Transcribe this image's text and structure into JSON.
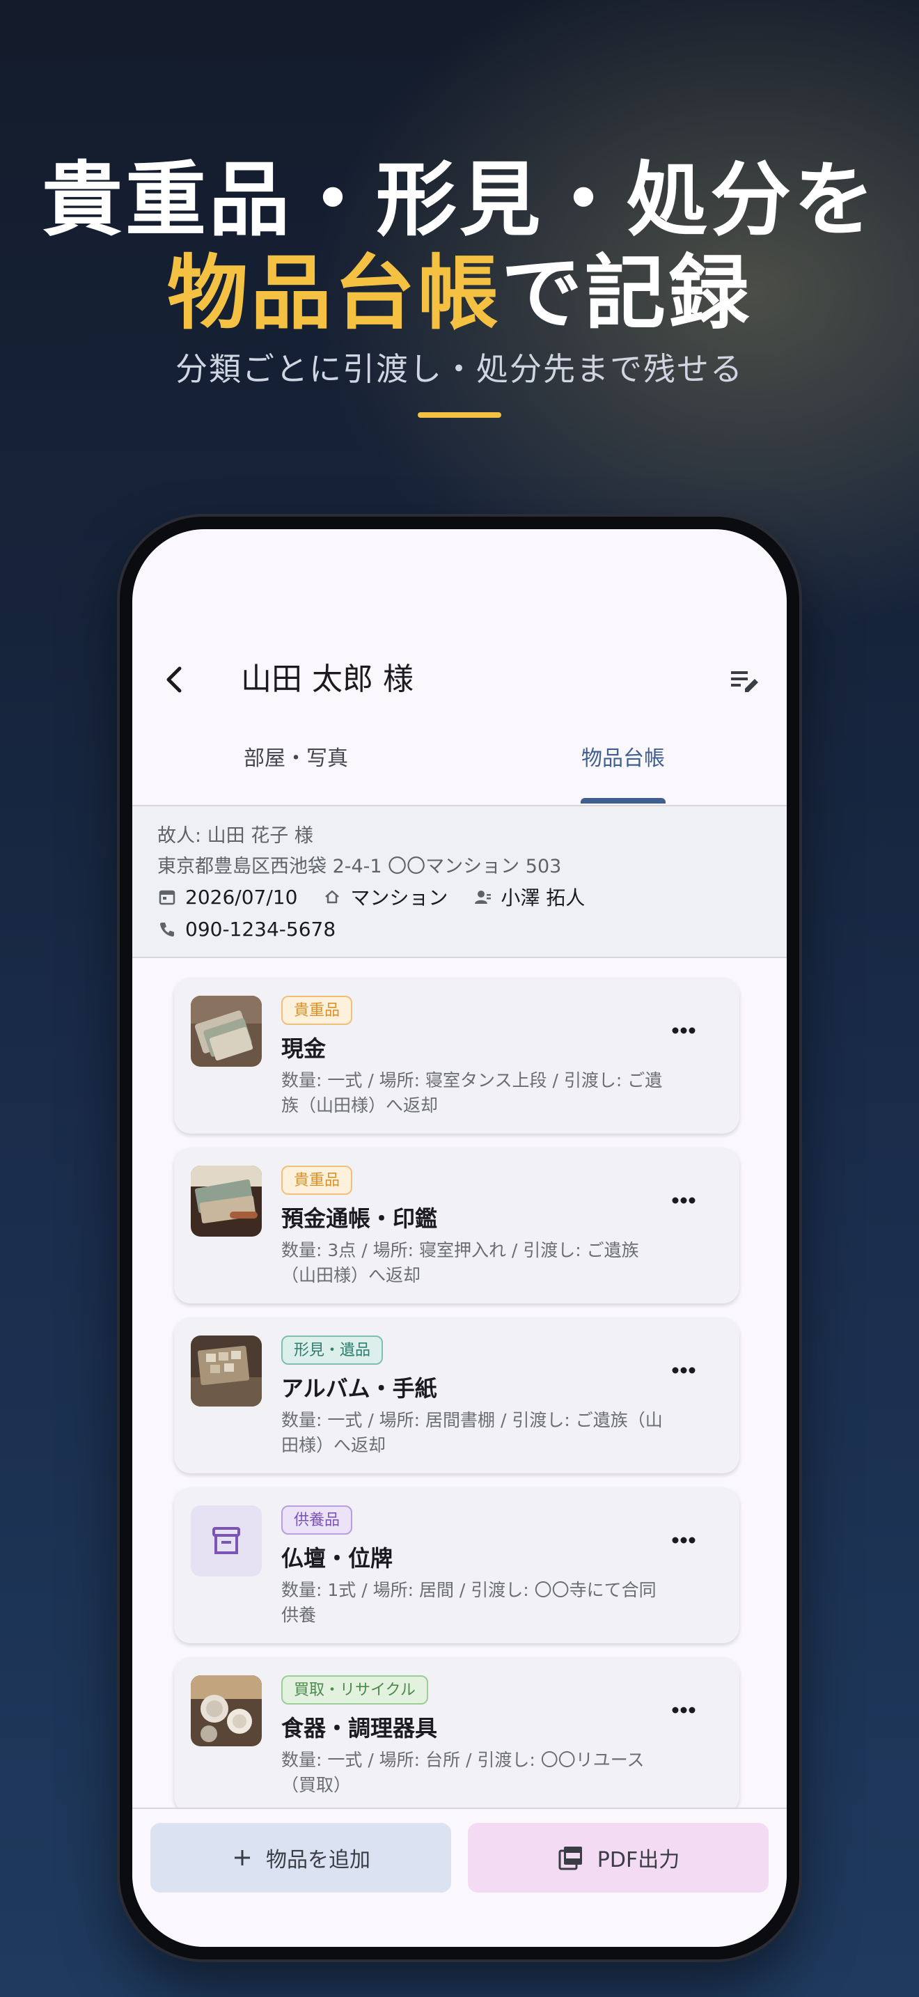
{
  "hero": {
    "line1": "貴重品・形見・処分を",
    "line2_accent": "物品台帳",
    "line2_rest": "で記録",
    "subtitle": "分類ごとに引渡し・処分先まで残せる",
    "accent_color": "#f4c143"
  },
  "appbar": {
    "title": "山田 太郎 様",
    "back_icon": "arrow-back-icon",
    "edit_icon": "edit-note-icon"
  },
  "tabs": [
    {
      "label": "部屋・写真",
      "active": false
    },
    {
      "label": "物品台帳",
      "active": true
    }
  ],
  "info": {
    "deceased": "故人: 山田 花子 様",
    "address": "東京都豊島区西池袋 2-4-1 〇〇マンション 503",
    "date": "2026/07/10",
    "building": "マンション",
    "staff": "小澤 拓人",
    "phone": "090-1234-5678"
  },
  "items": [
    {
      "tag": "貴重品",
      "name": "現金",
      "detail": "数量: 一式 / 場所: 寝室タンス上段 / 引渡し: ご遺族（山田様）へ返却",
      "thumb": "cash-photo"
    },
    {
      "tag": "貴重品",
      "name": "預金通帳・印鑑",
      "detail": "数量: 3点 / 場所: 寝室押入れ / 引渡し: ご遺族（山田様）へ返却",
      "thumb": "bankbook-photo"
    },
    {
      "tag": "形見・遺品",
      "name": "アルバム・手紙",
      "detail": "数量: 一式 / 場所: 居間書棚 / 引渡し: ご遺族（山田様）へ返却",
      "thumb": "album-photo"
    },
    {
      "tag": "供養品",
      "name": "仏壇・位牌",
      "detail": "数量: 1式 / 場所: 居間 / 引渡し: 〇〇寺にて合同供養",
      "thumb": "archive-icon"
    },
    {
      "tag": "買取・リサイクル",
      "name": "食器・調理器具",
      "detail": "数量: 一式 / 場所: 台所 / 引渡し: 〇〇リユース（買取）",
      "thumb": "dishes-photo"
    }
  ],
  "tag_colors": {
    "valuable": {
      "text": "#d9912a",
      "border": "#f0c07a",
      "bg": "#fdf1dc"
    },
    "memento": {
      "text": "#2f7d70",
      "border": "#7fbfb3",
      "bg": "#dcefeb"
    },
    "memorial": {
      "text": "#7a55b5",
      "border": "#b89ee0",
      "bg": "#ece3f8"
    },
    "recycle": {
      "text": "#4c8a4b",
      "border": "#9ccc98",
      "bg": "#e3f1df"
    }
  },
  "bottom": {
    "add_label": "物品を追加",
    "pdf_label": "PDF出力"
  }
}
